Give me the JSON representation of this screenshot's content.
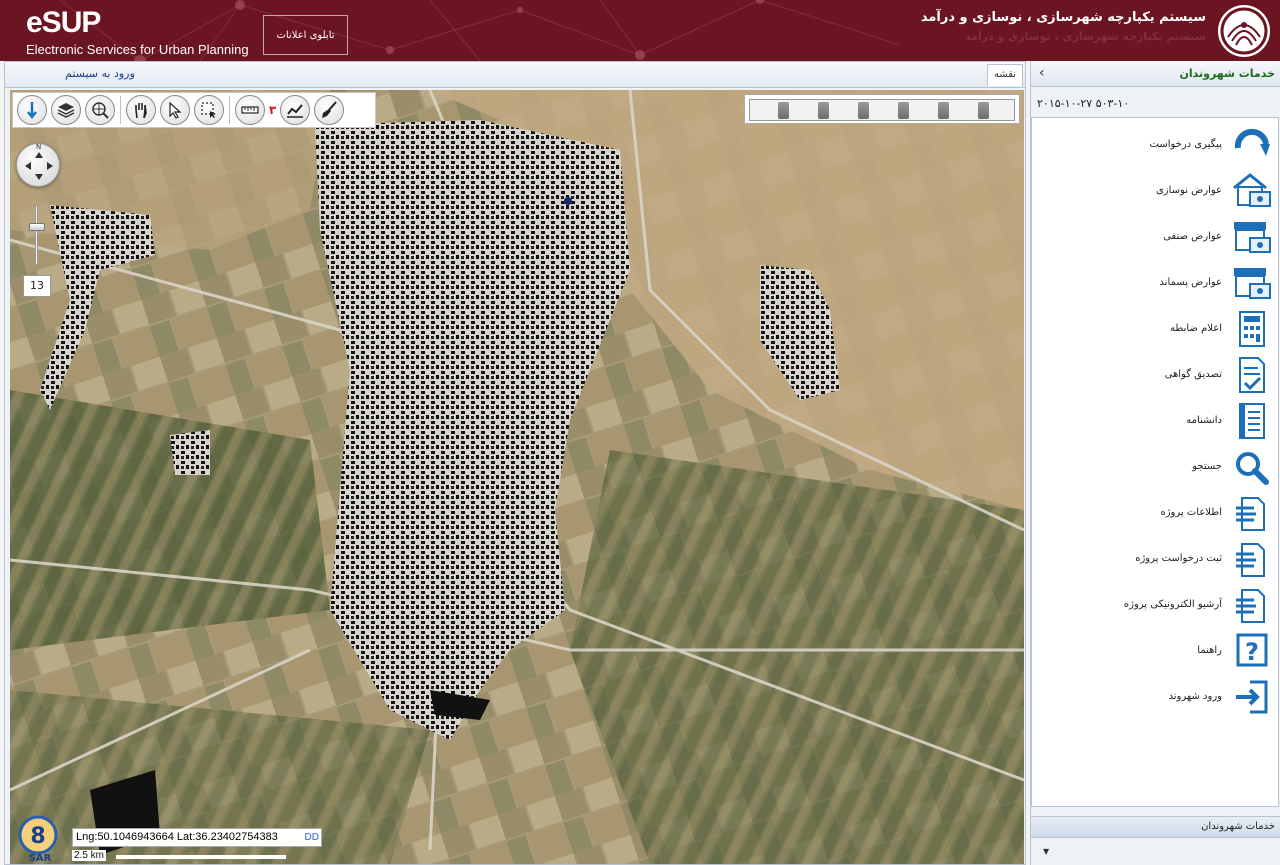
{
  "header": {
    "logo_text": "eSUP",
    "logo_subtitle": "Electronic Services for Urban Planning",
    "board_button": "تابلوی اعلانات",
    "system_title": "سیستم یکپارچه شهرسازی ، نوسازی و درآمد",
    "system_brand": "یکپارچه",
    "background_color": "#6b1422"
  },
  "map_panel": {
    "login_link": "ورود به سیستم",
    "tab_label": "نقشه",
    "tool_count": "۳",
    "zoom_level": "13",
    "zoom_fraction": 0.35,
    "coords_text": "Lng:50.1046943664   Lat:36.23402754383",
    "coords_unit": "DD",
    "scale_label": "2.5 km",
    "toolbar_icons": [
      "broom-icon",
      "chart-icon",
      "ruler-icon",
      "select-box-icon",
      "pointer-icon",
      "pan-hand-icon",
      "globe-search-icon",
      "layers-icon",
      "info-pin-icon"
    ],
    "badge": "SAR"
  },
  "sidebar": {
    "title": "خدمات شهروندان",
    "collapse_icon": "chevron-left-icon",
    "date_text": "۲۰۱۵-۱۰-۲۷ ۵۰۳-۱۰",
    "footer_label": "خدمات شهروندان",
    "items": [
      {
        "label": "پیگیری درخواست",
        "icon": "refresh-arrow-icon"
      },
      {
        "label": "عوارض نوسازی",
        "icon": "house-money-icon"
      },
      {
        "label": "عوارض صنفی",
        "icon": "shop-money-icon"
      },
      {
        "label": "عوارض پسماند",
        "icon": "shop-waste-icon"
      },
      {
        "label": "اعلام ضابطه",
        "icon": "calculator-doc-icon"
      },
      {
        "label": "تصدیق گواهی",
        "icon": "certificate-check-icon"
      },
      {
        "label": "دانشنامه",
        "icon": "encyclopedia-icon"
      },
      {
        "label": "جستجو",
        "icon": "search-icon"
      },
      {
        "label": "اطلاعات پروژه",
        "icon": "project-info-icon"
      },
      {
        "label": "ثبت درخواست پروژه",
        "icon": "project-request-icon"
      },
      {
        "label": "آرشیو الکترونیکی پروژه",
        "icon": "project-archive-icon"
      },
      {
        "label": "راهنما",
        "icon": "help-icon"
      },
      {
        "label": "ورود شهروند",
        "icon": "login-arrow-icon"
      }
    ]
  },
  "colors": {
    "accent": "#1d6fb8",
    "sidebar_title": "#1b6b1b",
    "link": "#1a3c8a"
  }
}
